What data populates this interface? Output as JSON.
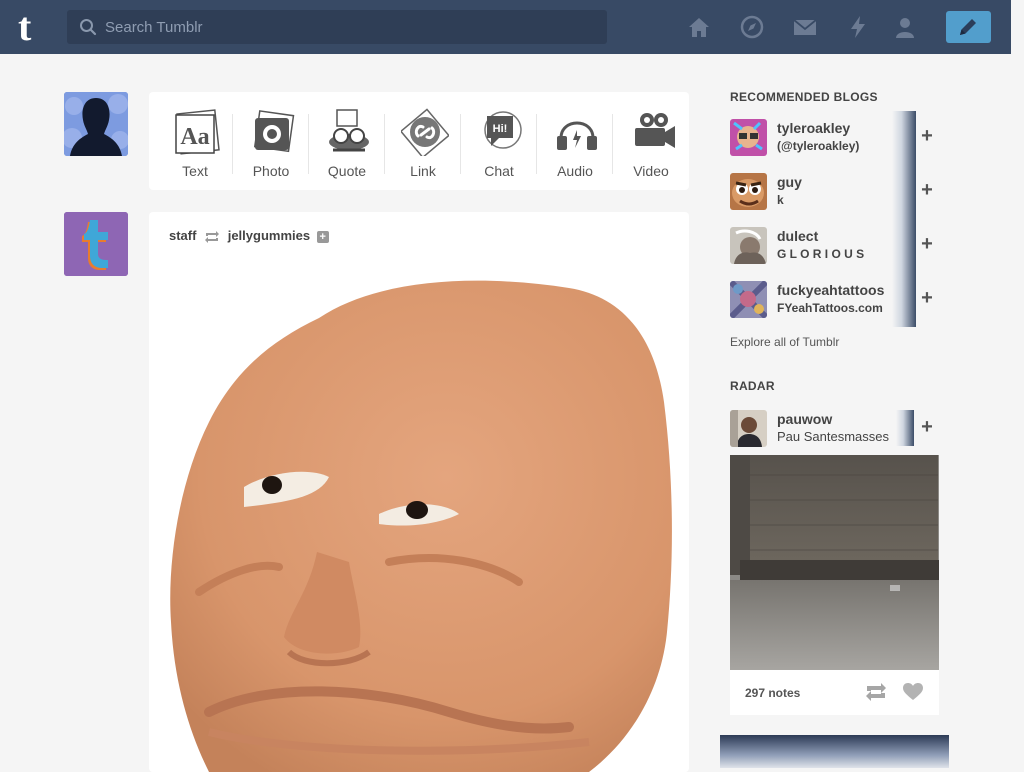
{
  "header": {
    "logo": "t",
    "search": {
      "placeholder": "Search Tumblr"
    },
    "nav_icons": [
      "home-icon",
      "explore-compass-icon",
      "mail-icon",
      "activity-bolt-icon",
      "account-person-icon"
    ],
    "compose_icon": "pencil-icon"
  },
  "post_types": [
    {
      "label": "Text",
      "icon": "text-icon"
    },
    {
      "label": "Photo",
      "icon": "camera-icon"
    },
    {
      "label": "Quote",
      "icon": "quote-icon"
    },
    {
      "label": "Link",
      "icon": "link-icon"
    },
    {
      "label": "Chat",
      "icon": "chat-icon"
    },
    {
      "label": "Audio",
      "icon": "headphones-icon"
    },
    {
      "label": "Video",
      "icon": "video-camera-icon"
    }
  ],
  "post": {
    "author": "staff",
    "reblogged_from": "jellygummies",
    "follow_symbol": "+"
  },
  "sidebar": {
    "recommended_title": "RECOMMENDED BLOGS",
    "recommended": [
      {
        "name": "tyleroakley",
        "sub": "(@tyleroakley)"
      },
      {
        "name": "guy",
        "sub": "k"
      },
      {
        "name": "dulect",
        "sub": "G L O R I O U S"
      },
      {
        "name": "fuckyeahtattoos",
        "sub": "FYeahTattoos.com"
      }
    ],
    "follow_symbol": "+",
    "explore": "Explore all of Tumblr",
    "radar_title": "RADAR",
    "radar": {
      "name": "pauwow",
      "sub": "Pau Santesmasses",
      "notes": "297 notes"
    }
  },
  "colors": {
    "header": "#384a65",
    "compose": "#529ecc",
    "background": "#f5f5f5"
  }
}
